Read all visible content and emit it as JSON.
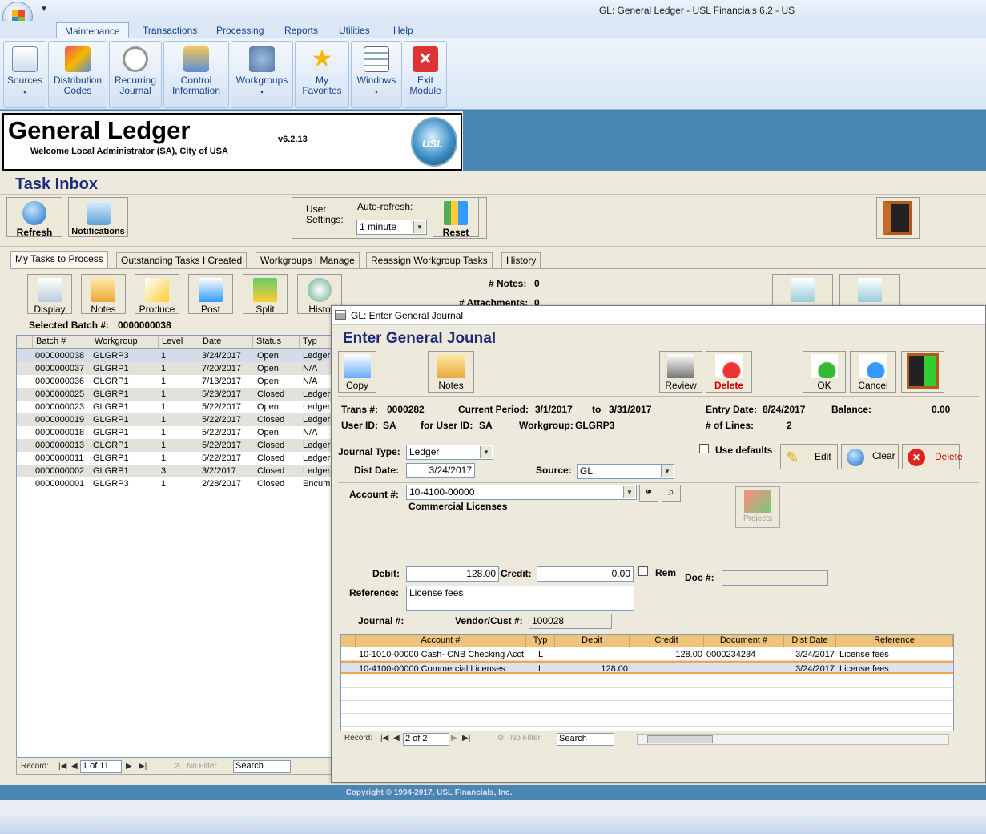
{
  "window": {
    "title": "GL: General Ledger - USL Financials 6.2 - US",
    "qat_icon": "GL"
  },
  "ribbon": {
    "tabs": [
      "Maintenance",
      "Transactions",
      "Processing",
      "Reports",
      "Utilities",
      "Help"
    ],
    "active_tab": "Maintenance",
    "buttons": [
      {
        "label": "Sources",
        "icon": "sources-icon"
      },
      {
        "label": "Distribution Codes",
        "icon": "distribution-codes-icon"
      },
      {
        "label": "Recurring Journal",
        "icon": "clock-icon"
      },
      {
        "label": "Control Information",
        "icon": "control-info-icon"
      },
      {
        "label": "Workgroups",
        "icon": "workgroups-icon"
      },
      {
        "label": "My Favorites",
        "icon": "star-icon"
      },
      {
        "label": "Windows",
        "icon": "windows-icon"
      },
      {
        "label": "Exit Module",
        "icon": "exit-icon"
      }
    ]
  },
  "header": {
    "title": "General Ledger",
    "welcome": "Welcome Local Administrator (SA), City of USA",
    "version": "v6.2.13",
    "logo_text": "USL"
  },
  "task_inbox": {
    "title": "Task Inbox",
    "refresh": "Refresh",
    "notifications": "Notifications",
    "user_settings_label": "User Settings:",
    "auto_refresh_label": "Auto-refresh:",
    "auto_refresh_value": "1 minute",
    "reset": "Reset"
  },
  "subtabs": [
    "My Tasks to Process",
    "Outstanding Tasks I Created",
    "Workgroups I Manage",
    "Reassign Workgroup Tasks",
    "History"
  ],
  "task_toolbar": [
    "Display",
    "Notes",
    "Produce",
    "Post",
    "Split",
    "Histo"
  ],
  "counts": {
    "notes_label": "# Notes:",
    "notes_value": "0",
    "attachments_label": "# Attachments:",
    "attachments_value": "0"
  },
  "selected_batch": {
    "label": "Selected Batch #:",
    "value": "0000000038"
  },
  "batch_grid": {
    "columns": [
      "Batch #",
      "Workgroup",
      "Level",
      "Date",
      "Status",
      "Typ"
    ],
    "rows": [
      [
        "0000000038",
        "GLGRP3",
        "1",
        "3/24/2017",
        "Open",
        "Ledger"
      ],
      [
        "0000000037",
        "GLGRP1",
        "1",
        "7/20/2017",
        "Open",
        "N/A"
      ],
      [
        "0000000036",
        "GLGRP1",
        "1",
        "7/13/2017",
        "Open",
        "N/A"
      ],
      [
        "0000000025",
        "GLGRP1",
        "1",
        "5/23/2017",
        "Closed",
        "Ledger"
      ],
      [
        "0000000023",
        "GLGRP1",
        "1",
        "5/22/2017",
        "Open",
        "Ledger"
      ],
      [
        "0000000019",
        "GLGRP1",
        "1",
        "5/22/2017",
        "Closed",
        "Ledger"
      ],
      [
        "0000000018",
        "GLGRP1",
        "1",
        "5/22/2017",
        "Open",
        "N/A"
      ],
      [
        "0000000013",
        "GLGRP1",
        "1",
        "5/22/2017",
        "Closed",
        "Ledger"
      ],
      [
        "0000000011",
        "GLGRP1",
        "1",
        "5/22/2017",
        "Closed",
        "Ledger"
      ],
      [
        "0000000002",
        "GLGRP1",
        "3",
        "3/2/2017",
        "Closed",
        "Ledger"
      ],
      [
        "0000000001",
        "GLGRP3",
        "1",
        "2/28/2017",
        "Closed",
        "Encumb"
      ]
    ],
    "record_label": "Record:",
    "record_value": "1 of 11",
    "no_filter": "No Filter",
    "search": "Search"
  },
  "dialog": {
    "title": "GL:  Enter General Journal",
    "heading": "Enter General Jounal",
    "toolbar": [
      "Copy",
      "Notes",
      "Review",
      "Delete",
      "OK",
      "Cancel"
    ],
    "trans_label": "Trans #:",
    "trans_value": "0000282",
    "period_label": "Current Period:",
    "period_from": "3/1/2017",
    "period_to_label": "to",
    "period_to": "3/31/2017",
    "entry_date_label": "Entry Date:",
    "entry_date": "8/24/2017",
    "balance_label": "Balance:",
    "balance": "0.00",
    "user_label": "User ID:",
    "user_value": "SA",
    "for_user_label": "for User ID:",
    "for_user_value": "SA",
    "workgroup_label": "Workgroup:",
    "workgroup_value": "GLGRP3",
    "lines_label": "# of Lines:",
    "lines_value": "2",
    "journal_type_label": "Journal Type:",
    "journal_type": "Ledger",
    "use_defaults": "Use defaults",
    "edit": "Edit",
    "clear": "Clear",
    "delete": "Delete",
    "dist_date_label": "Dist Date:",
    "dist_date": "3/24/2017",
    "source_label": "Source:",
    "source": "GL",
    "account_label": "Account #:",
    "account": "10-4100-00000",
    "account_desc": "Commercial Licenses",
    "projects": "Projects",
    "debit_label": "Debit:",
    "debit": "128.00",
    "credit_label": "Credit:",
    "credit": "0.00",
    "rem_label": "Rem",
    "doc_label": "Doc #:",
    "doc": "",
    "reference_label": "Reference:",
    "reference": "License fees",
    "journal_label": "Journal #:",
    "vendor_label": "Vendor/Cust #:",
    "vendor": "100028"
  },
  "lines_grid": {
    "columns": [
      "Account #",
      "Typ",
      "Debit",
      "Credit",
      "Document #",
      "Dist Date",
      "Reference"
    ],
    "rows": [
      [
        "10-1010-00000  Cash- CNB Checking Acct",
        "L",
        "",
        "128.00",
        "0000234234",
        "3/24/2017",
        "License fees"
      ],
      [
        "10-4100-00000  Commercial Licenses",
        "L",
        "128.00",
        "",
        "",
        "3/24/2017",
        "License fees"
      ]
    ],
    "record_label": "Record:",
    "record_value": "2 of 2",
    "no_filter": "No Filter",
    "search": "Search"
  },
  "footer": {
    "copyright": "Copyright © 1994-2017, USL Financials, Inc."
  }
}
